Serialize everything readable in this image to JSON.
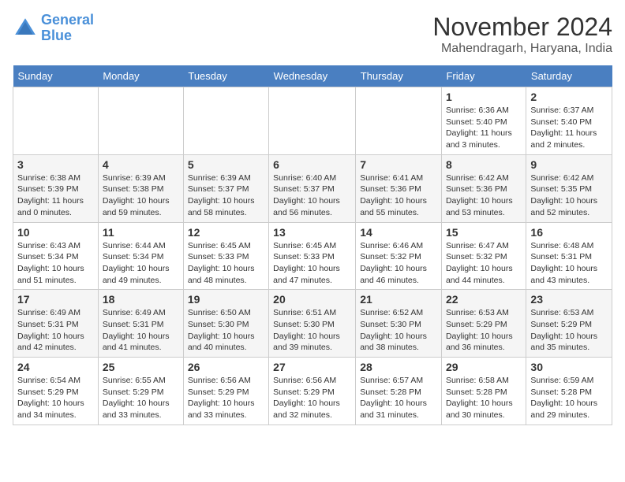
{
  "logo": {
    "line1": "General",
    "line2": "Blue"
  },
  "title": "November 2024",
  "subtitle": "Mahendragarh, Haryana, India",
  "days_of_week": [
    "Sunday",
    "Monday",
    "Tuesday",
    "Wednesday",
    "Thursday",
    "Friday",
    "Saturday"
  ],
  "weeks": [
    [
      {
        "num": "",
        "sunrise": "",
        "sunset": "",
        "daylight": ""
      },
      {
        "num": "",
        "sunrise": "",
        "sunset": "",
        "daylight": ""
      },
      {
        "num": "",
        "sunrise": "",
        "sunset": "",
        "daylight": ""
      },
      {
        "num": "",
        "sunrise": "",
        "sunset": "",
        "daylight": ""
      },
      {
        "num": "",
        "sunrise": "",
        "sunset": "",
        "daylight": ""
      },
      {
        "num": "1",
        "sunrise": "Sunrise: 6:36 AM",
        "sunset": "Sunset: 5:40 PM",
        "daylight": "Daylight: 11 hours and 3 minutes."
      },
      {
        "num": "2",
        "sunrise": "Sunrise: 6:37 AM",
        "sunset": "Sunset: 5:40 PM",
        "daylight": "Daylight: 11 hours and 2 minutes."
      }
    ],
    [
      {
        "num": "3",
        "sunrise": "Sunrise: 6:38 AM",
        "sunset": "Sunset: 5:39 PM",
        "daylight": "Daylight: 11 hours and 0 minutes."
      },
      {
        "num": "4",
        "sunrise": "Sunrise: 6:39 AM",
        "sunset": "Sunset: 5:38 PM",
        "daylight": "Daylight: 10 hours and 59 minutes."
      },
      {
        "num": "5",
        "sunrise": "Sunrise: 6:39 AM",
        "sunset": "Sunset: 5:37 PM",
        "daylight": "Daylight: 10 hours and 58 minutes."
      },
      {
        "num": "6",
        "sunrise": "Sunrise: 6:40 AM",
        "sunset": "Sunset: 5:37 PM",
        "daylight": "Daylight: 10 hours and 56 minutes."
      },
      {
        "num": "7",
        "sunrise": "Sunrise: 6:41 AM",
        "sunset": "Sunset: 5:36 PM",
        "daylight": "Daylight: 10 hours and 55 minutes."
      },
      {
        "num": "8",
        "sunrise": "Sunrise: 6:42 AM",
        "sunset": "Sunset: 5:36 PM",
        "daylight": "Daylight: 10 hours and 53 minutes."
      },
      {
        "num": "9",
        "sunrise": "Sunrise: 6:42 AM",
        "sunset": "Sunset: 5:35 PM",
        "daylight": "Daylight: 10 hours and 52 minutes."
      }
    ],
    [
      {
        "num": "10",
        "sunrise": "Sunrise: 6:43 AM",
        "sunset": "Sunset: 5:34 PM",
        "daylight": "Daylight: 10 hours and 51 minutes."
      },
      {
        "num": "11",
        "sunrise": "Sunrise: 6:44 AM",
        "sunset": "Sunset: 5:34 PM",
        "daylight": "Daylight: 10 hours and 49 minutes."
      },
      {
        "num": "12",
        "sunrise": "Sunrise: 6:45 AM",
        "sunset": "Sunset: 5:33 PM",
        "daylight": "Daylight: 10 hours and 48 minutes."
      },
      {
        "num": "13",
        "sunrise": "Sunrise: 6:45 AM",
        "sunset": "Sunset: 5:33 PM",
        "daylight": "Daylight: 10 hours and 47 minutes."
      },
      {
        "num": "14",
        "sunrise": "Sunrise: 6:46 AM",
        "sunset": "Sunset: 5:32 PM",
        "daylight": "Daylight: 10 hours and 46 minutes."
      },
      {
        "num": "15",
        "sunrise": "Sunrise: 6:47 AM",
        "sunset": "Sunset: 5:32 PM",
        "daylight": "Daylight: 10 hours and 44 minutes."
      },
      {
        "num": "16",
        "sunrise": "Sunrise: 6:48 AM",
        "sunset": "Sunset: 5:31 PM",
        "daylight": "Daylight: 10 hours and 43 minutes."
      }
    ],
    [
      {
        "num": "17",
        "sunrise": "Sunrise: 6:49 AM",
        "sunset": "Sunset: 5:31 PM",
        "daylight": "Daylight: 10 hours and 42 minutes."
      },
      {
        "num": "18",
        "sunrise": "Sunrise: 6:49 AM",
        "sunset": "Sunset: 5:31 PM",
        "daylight": "Daylight: 10 hours and 41 minutes."
      },
      {
        "num": "19",
        "sunrise": "Sunrise: 6:50 AM",
        "sunset": "Sunset: 5:30 PM",
        "daylight": "Daylight: 10 hours and 40 minutes."
      },
      {
        "num": "20",
        "sunrise": "Sunrise: 6:51 AM",
        "sunset": "Sunset: 5:30 PM",
        "daylight": "Daylight: 10 hours and 39 minutes."
      },
      {
        "num": "21",
        "sunrise": "Sunrise: 6:52 AM",
        "sunset": "Sunset: 5:30 PM",
        "daylight": "Daylight: 10 hours and 38 minutes."
      },
      {
        "num": "22",
        "sunrise": "Sunrise: 6:53 AM",
        "sunset": "Sunset: 5:29 PM",
        "daylight": "Daylight: 10 hours and 36 minutes."
      },
      {
        "num": "23",
        "sunrise": "Sunrise: 6:53 AM",
        "sunset": "Sunset: 5:29 PM",
        "daylight": "Daylight: 10 hours and 35 minutes."
      }
    ],
    [
      {
        "num": "24",
        "sunrise": "Sunrise: 6:54 AM",
        "sunset": "Sunset: 5:29 PM",
        "daylight": "Daylight: 10 hours and 34 minutes."
      },
      {
        "num": "25",
        "sunrise": "Sunrise: 6:55 AM",
        "sunset": "Sunset: 5:29 PM",
        "daylight": "Daylight: 10 hours and 33 minutes."
      },
      {
        "num": "26",
        "sunrise": "Sunrise: 6:56 AM",
        "sunset": "Sunset: 5:29 PM",
        "daylight": "Daylight: 10 hours and 33 minutes."
      },
      {
        "num": "27",
        "sunrise": "Sunrise: 6:56 AM",
        "sunset": "Sunset: 5:29 PM",
        "daylight": "Daylight: 10 hours and 32 minutes."
      },
      {
        "num": "28",
        "sunrise": "Sunrise: 6:57 AM",
        "sunset": "Sunset: 5:28 PM",
        "daylight": "Daylight: 10 hours and 31 minutes."
      },
      {
        "num": "29",
        "sunrise": "Sunrise: 6:58 AM",
        "sunset": "Sunset: 5:28 PM",
        "daylight": "Daylight: 10 hours and 30 minutes."
      },
      {
        "num": "30",
        "sunrise": "Sunrise: 6:59 AM",
        "sunset": "Sunset: 5:28 PM",
        "daylight": "Daylight: 10 hours and 29 minutes."
      }
    ]
  ]
}
